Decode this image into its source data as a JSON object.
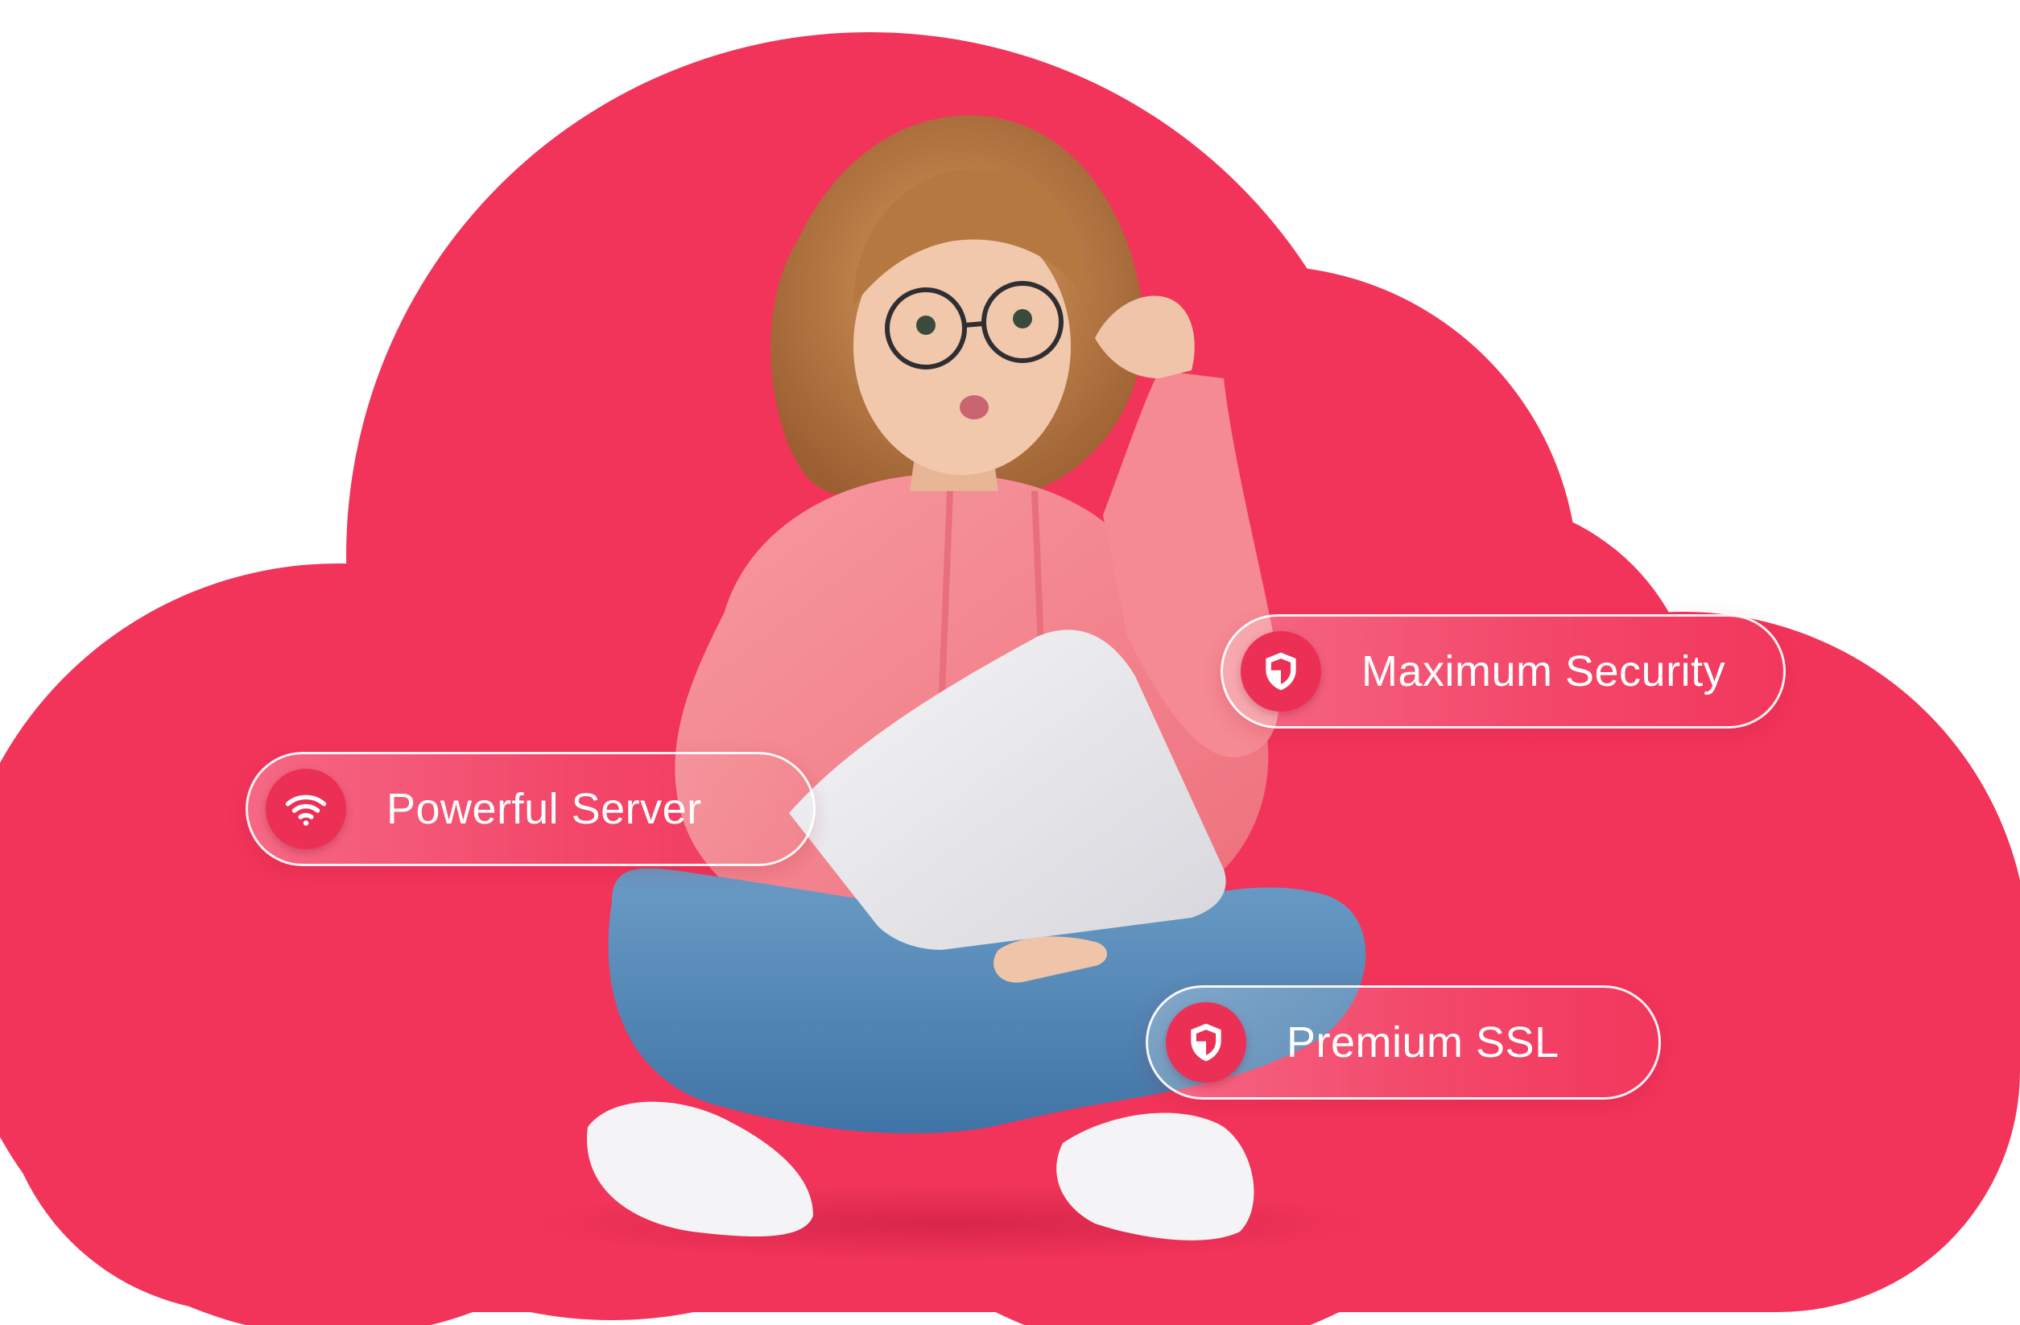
{
  "features": [
    {
      "label": "Maximum Security",
      "icon": "shield-icon"
    },
    {
      "label": "Powerful Server",
      "icon": "wifi-icon"
    },
    {
      "label": "Premium SSL",
      "icon": "shield-icon"
    }
  ],
  "colors": {
    "cloud": "#f2345a",
    "icon_circle": "#ec2f55",
    "hoodie": "#f47f88",
    "jeans": "#4f86b6",
    "laptop": "#e9e9ec",
    "hair": "#b77a45",
    "skin": "#f0c4a8"
  }
}
